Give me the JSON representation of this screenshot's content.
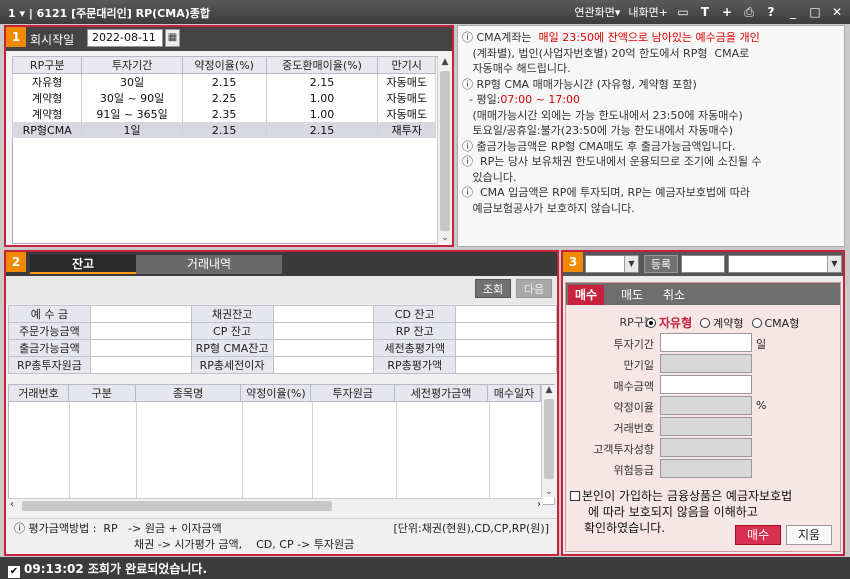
{
  "window": {
    "title_left": "1 ▾ | 6121 [주문대리인] RP(CMA)종합",
    "menu_related": "연관화면▾",
    "menu_mine": "내화면+",
    "icons": [
      "monitor-icon",
      "text-icon",
      "plus-icon",
      "print-icon",
      "help-icon",
      "minimize-icon",
      "maximize-icon",
      "close-icon"
    ]
  },
  "panel1": {
    "badge": "1",
    "date_label": "회시작일",
    "date_value": "2022-08-11",
    "table": {
      "headers": [
        "RP구분",
        "투자기간",
        "약정이율(%)",
        "중도환매이율(%)",
        "만기시"
      ],
      "rows": [
        [
          "자유형",
          "30일",
          "2.15",
          "2.15",
          "자동매도"
        ],
        [
          "계약형",
          "30일 ~ 90일",
          "2.25",
          "1.00",
          "자동매도"
        ],
        [
          "계약형",
          "91일 ~ 365일",
          "2.35",
          "1.00",
          "자동매도"
        ],
        [
          "RP형CMA",
          "1일",
          "2.15",
          "2.15",
          "재투자"
        ]
      ]
    }
  },
  "notes": {
    "lines": [
      {
        "pre": "ⓘ CMA계좌는  ",
        "red": "매일 23:50에 잔액으로 남아있는 예수금을 개인",
        "post": ""
      },
      {
        "pre": "   (계좌별), 법인(사업자번호별) 20억 한도에서 RP형  CMA로",
        "red": "",
        "post": ""
      },
      {
        "pre": "   자동매수 해드립니다.",
        "red": "",
        "post": ""
      },
      {
        "pre": "ⓘ RP형 CMA 매매가능시간 (자유형, 계약형 포함)",
        "red": "",
        "post": ""
      },
      {
        "pre": "  - 평일:",
        "red": "07:00 ~ 17:00",
        "post": ""
      },
      {
        "pre": "   (매매가능시간 외에는 가능 한도내에서 23:50에 자동매수)",
        "red": "",
        "post": ""
      },
      {
        "pre": "   토요일/공휴일:불가(23:50에 가능 한도내에서 자동매수)",
        "red": "",
        "post": ""
      },
      {
        "pre": "ⓘ 출금가능금액은 RP형 CMA매도 후 출금가능금액입니다.",
        "red": "",
        "post": ""
      },
      {
        "pre": "ⓘ  RP는 당사 보유채권 한도내에서 운용되므로 조기에 소진될 수",
        "red": "",
        "post": ""
      },
      {
        "pre": "   있습니다.",
        "red": "",
        "post": ""
      },
      {
        "pre": "ⓘ  CMA 입금액은 RP에 투자되며, RP는 예금자보호법에 따라",
        "red": "",
        "post": ""
      },
      {
        "pre": "   예금보험공사가 보호하지 않습니다.",
        "red": "",
        "post": ""
      }
    ]
  },
  "panel2": {
    "badge": "2",
    "tabs": [
      "잔고",
      "거래내역"
    ],
    "btn_query": "조회",
    "btn_next": "다음",
    "summary": [
      [
        "예  수  금",
        "",
        "채권잔고",
        "",
        "CD  잔고",
        ""
      ],
      [
        "주문가능금액",
        "",
        "CP  잔고",
        "",
        "RP  잔고",
        ""
      ],
      [
        "출금가능금액",
        "",
        "RP형 CMA잔고",
        "",
        "세전총평가액",
        ""
      ],
      [
        "RP총투자원금",
        "",
        "RP총세전이자",
        "",
        "RP총평가액",
        ""
      ]
    ],
    "tx_headers": [
      "거래번호",
      "구분",
      "종목명",
      "약정이율(%)",
      "투자원금",
      "세전평가금액",
      "매수일자"
    ],
    "footer_line1": "ⓘ 평가금액방법 :  RP   -> 원금 + 이자금액",
    "footer_unit": "[단위:채권(현원),CD,CP,RP(원)]",
    "footer_line2": "채권 -> 시가평가 금액,    CD, CP -> 투자원금"
  },
  "panel3": {
    "badge": "3",
    "register_btn": "등록",
    "tabs": [
      "매수",
      "매도",
      "취소"
    ],
    "rp_type_label": "RP구분",
    "rp_options": [
      "자유형",
      "계약형",
      "CMA형"
    ],
    "rp_selected": "자유형",
    "fields": [
      {
        "label": "투자기간",
        "unit": "일",
        "readonly": false
      },
      {
        "label": "만기일",
        "unit": "",
        "readonly": true
      },
      {
        "label": "매수금액",
        "unit": "",
        "readonly": false
      },
      {
        "label": "약정이율",
        "unit": "%",
        "readonly": true
      },
      {
        "label": "거래번호",
        "unit": "",
        "readonly": true
      },
      {
        "label": "고객투자성향",
        "unit": "",
        "readonly": true
      },
      {
        "label": "위험등급",
        "unit": "",
        "readonly": true
      }
    ],
    "consent_line1": "본인이 가입하는 금융상품은 예금자보호법",
    "consent_line2": "에 따라 보호되지 않음을 이해하고",
    "consent_line3": "확인하였습니다.",
    "buy_btn": "매수",
    "clear_btn": "지움"
  },
  "status": {
    "text": "09:13:02 조회가 완료되었습니다."
  }
}
